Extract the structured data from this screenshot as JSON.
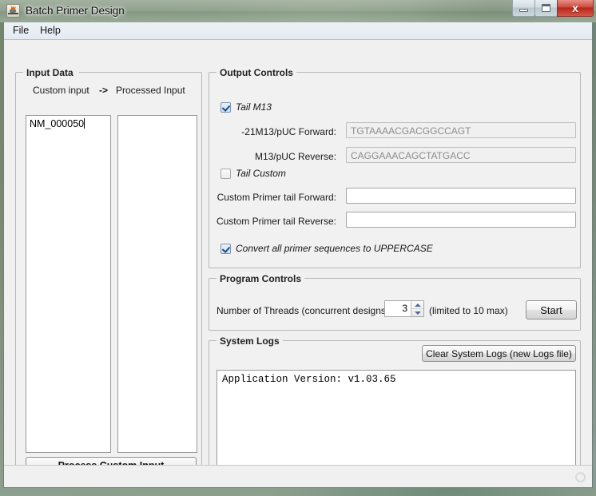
{
  "window": {
    "title": "Batch Primer Design",
    "icon": "java-coffee-cup-icon",
    "buttons": {
      "minimize": "–",
      "maximize": "□",
      "close": "x"
    }
  },
  "menubar": {
    "items": [
      {
        "label": "File"
      },
      {
        "label": "Help"
      }
    ]
  },
  "input_panel": {
    "title": "Input Data",
    "custom_input_label": "Custom input",
    "arrow_label": "->",
    "processed_input_label": "Processed Input",
    "custom_input_value": "NM_000050",
    "processed_input_value": "",
    "process_button": "Process Custom Input"
  },
  "output_panel": {
    "title": "Output Controls",
    "tail_m13": {
      "label": "Tail M13",
      "checked": true
    },
    "forward_label": "-21M13/pUC Forward:",
    "forward_value": "TGTAAAACGACGGCCAGT",
    "reverse_label": "M13/pUC Reverse:",
    "reverse_value": "CAGGAAACAGCTATGACC",
    "tail_custom": {
      "label": "Tail Custom",
      "checked": false
    },
    "custom_forward_label": "Custom Primer tail Forward:",
    "custom_forward_value": "",
    "custom_reverse_label": "Custom Primer tail Reverse:",
    "custom_reverse_value": "",
    "uppercase": {
      "label": "Convert all primer sequences to UPPERCASE",
      "checked": true
    }
  },
  "program_panel": {
    "title": "Program Controls",
    "threads_label": "Number of Threads (concurrent designs):",
    "threads_value": "3",
    "threads_hint": "(limited to 10 max)",
    "start_button": "Start"
  },
  "logs_panel": {
    "title": "System Logs",
    "clear_button": "Clear System Logs (new Logs file)",
    "log_text": "Application Version: v1.03.65"
  },
  "statusbar": {
    "resize_grip": "resize-grip-icon"
  }
}
